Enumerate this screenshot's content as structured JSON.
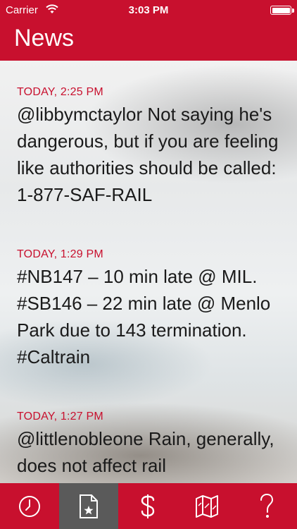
{
  "status_bar": {
    "carrier": "Carrier",
    "time": "3:03 PM",
    "wifi_icon": "wifi-icon",
    "battery_icon": "battery-icon"
  },
  "header": {
    "title": "News"
  },
  "news": [
    {
      "date": "TODAY, 2:25 PM",
      "text": "@libbymctaylor Not saying he's dangerous, but if you are feeling like authorities should be called: 1-877-SAF-RAIL"
    },
    {
      "date": "TODAY, 1:29 PM",
      "text": "#NB147 – 10 min late @ MIL. #SB146 – 22 min late @ Menlo Park due to 143 termination. #Caltrain"
    },
    {
      "date": "TODAY, 1:27 PM",
      "text": "@littlenobleone Rain, generally, does not affect rail"
    }
  ],
  "tab_bar": {
    "tabs": [
      {
        "icon": "clock-icon",
        "active": false
      },
      {
        "icon": "news-document-icon",
        "active": true
      },
      {
        "icon": "dollar-icon",
        "active": false
      },
      {
        "icon": "map-icon",
        "active": false
      },
      {
        "icon": "help-icon",
        "active": false
      }
    ]
  },
  "colors": {
    "brand_red": "#c8102e",
    "active_tab": "#5a5a5a",
    "date_text": "#c8102e"
  }
}
